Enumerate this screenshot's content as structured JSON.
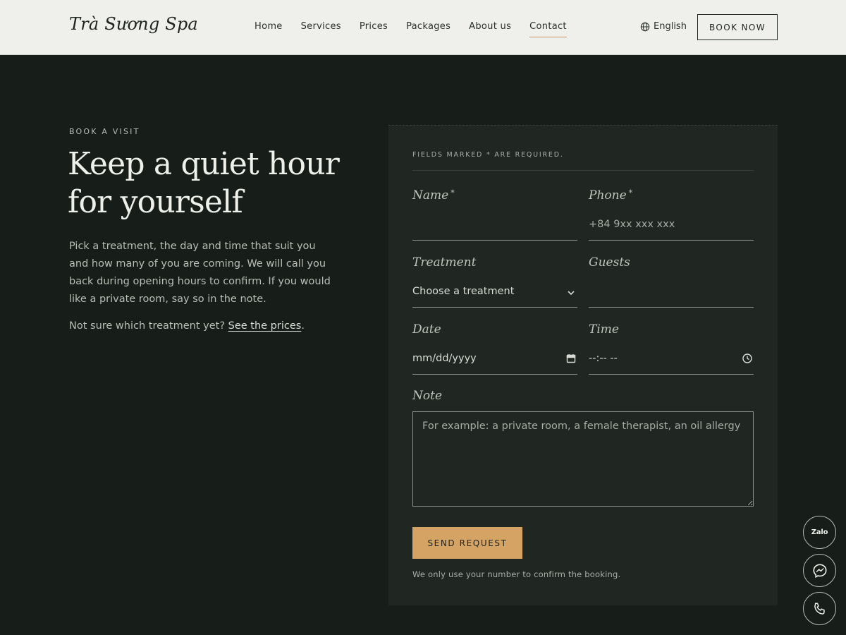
{
  "brand": {
    "logo": "Trà Sương Spa"
  },
  "nav": {
    "items": [
      {
        "label": "Home"
      },
      {
        "label": "Services"
      },
      {
        "label": "Prices"
      },
      {
        "label": "Packages"
      },
      {
        "label": "About us"
      },
      {
        "label": "Contact"
      }
    ],
    "active": "Contact",
    "language": "English",
    "book_label": "BOOK NOW"
  },
  "intro": {
    "eyebrow": "BOOK A VISIT",
    "headline": "Keep a quiet hour for yourself",
    "body": "Pick a treatment, the day and time that suit you and how many of you are coming. We will call you back during opening hours to confirm. If you would like a private room, say so in the note.",
    "prices_prompt": "Not sure which treatment yet?",
    "prices_link": "See the prices",
    "prices_suffix": "."
  },
  "form": {
    "required_note": "FIELDS MARKED * ARE REQUIRED.",
    "name": {
      "label": "Name",
      "required": "*",
      "value": ""
    },
    "phone": {
      "label": "Phone",
      "required": "*",
      "placeholder": "+84 9xx xxx xxx"
    },
    "treatment": {
      "label": "Treatment",
      "value": "Choose a treatment"
    },
    "guests": {
      "label": "Guests",
      "value": ""
    },
    "date": {
      "label": "Date",
      "placeholder": "mm/dd/yyyy"
    },
    "time": {
      "label": "Time",
      "placeholder": "--:-- --"
    },
    "note": {
      "label": "Note",
      "placeholder": "For example: a private room, a female therapist, an oil allergy"
    },
    "submit_label": "SEND REQUEST",
    "privacy": "We only use your number to confirm the booking."
  },
  "floating": {
    "zalo_label": "Zalo"
  },
  "colors": {
    "background": "#171d19",
    "card": "#202723",
    "accent": "#d5a464",
    "header": "#efefec"
  },
  "icons": [
    "globe-icon",
    "chevron-down-icon",
    "calendar-icon",
    "clock-icon",
    "messenger-icon",
    "phone-icon"
  ]
}
